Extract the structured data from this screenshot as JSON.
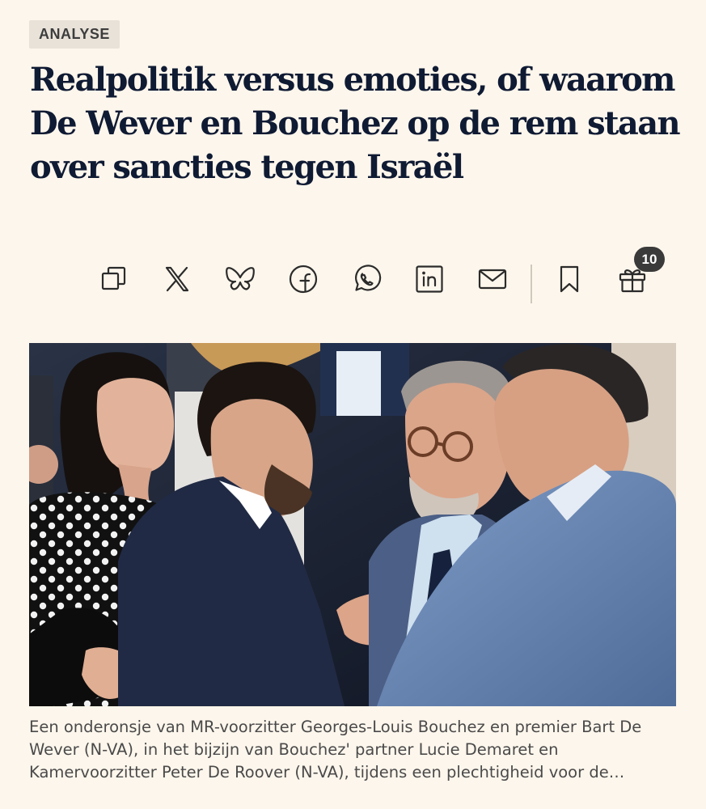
{
  "article": {
    "tag": "ANALYSE",
    "headline": "Realpolitik versus emoties, of waarom De Wever en Bouchez op de rem staan over sancties tegen Israël",
    "caption": "Een onderonsje van MR-voorzitter Georges-Louis Bouchez en premier Bart De Wever (N-VA), in het bijzijn van Bouchez' partner Lucie Demaret en Kamervoorzitter Peter De Roover (N-VA), tijdens een plechtigheid voor de…"
  },
  "share_bar": {
    "buttons": [
      {
        "name": "copy-link",
        "icon": "copy-icon"
      },
      {
        "name": "x",
        "icon": "x-logo-icon"
      },
      {
        "name": "bluesky",
        "icon": "bluesky-butterfly-icon"
      },
      {
        "name": "facebook",
        "icon": "facebook-icon"
      },
      {
        "name": "whatsapp",
        "icon": "whatsapp-icon"
      },
      {
        "name": "linkedin",
        "icon": "linkedin-icon"
      },
      {
        "name": "email",
        "icon": "mail-icon"
      },
      {
        "name": "bookmark",
        "icon": "bookmark-icon"
      },
      {
        "name": "gift",
        "icon": "gift-icon"
      }
    ],
    "gift_count": "10"
  },
  "colors": {
    "background": "#fdf6ec",
    "headline": "#0f1a33",
    "tag_bg": "#e8e2d9",
    "badge_bg": "#3a3a3a"
  }
}
